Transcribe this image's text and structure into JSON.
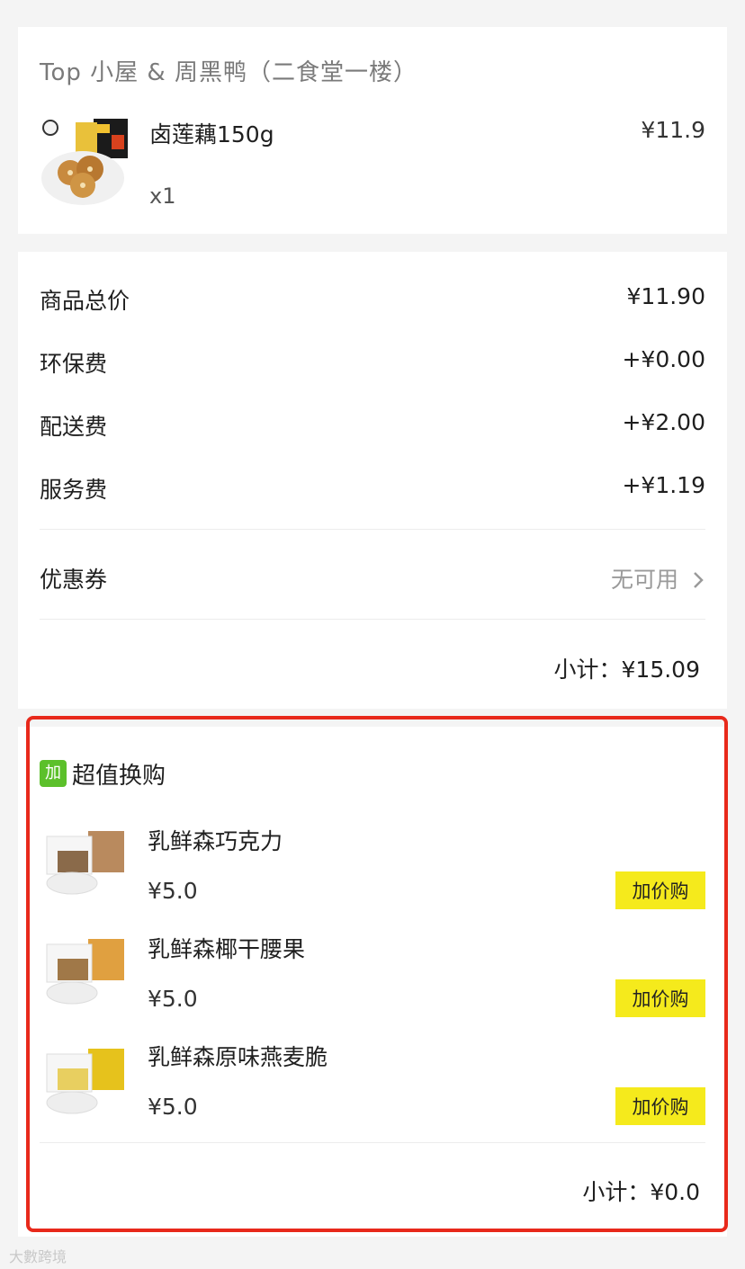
{
  "store": {
    "name": "Top 小屋 & 周黑鸭（二食堂一楼）",
    "item": {
      "name": "卤莲藕150g",
      "price": "¥11.9",
      "qty": "x1",
      "thumb_icon": "lotus-root-product-icon"
    }
  },
  "fees": {
    "rows": [
      {
        "label": "商品总价",
        "value": "¥11.90"
      },
      {
        "label": "环保费",
        "value": "+¥0.00"
      },
      {
        "label": "配送费",
        "value": "+¥2.00"
      },
      {
        "label": "服务费",
        "value": "+¥1.19"
      }
    ],
    "coupon": {
      "label": "优惠券",
      "value": "无可用",
      "icon": "chevron-right-icon"
    },
    "subtotal": "小计：¥15.09"
  },
  "addon": {
    "badge": "加",
    "title": "超值换购",
    "items": [
      {
        "name": "乳鲜森巧克力",
        "price": "¥5.0",
        "button": "加价购",
        "accent": "#b98a5e"
      },
      {
        "name": "乳鲜森椰干腰果",
        "price": "¥5.0",
        "button": "加价购",
        "accent": "#e0a040"
      },
      {
        "name": "乳鲜森原味燕麦脆",
        "price": "¥5.0",
        "button": "加价购",
        "accent": "#e6c21c"
      }
    ],
    "subtotal": "小计：¥0.0"
  },
  "colors": {
    "accent_green": "#5cc02b",
    "button_yellow": "#f5ea1c",
    "highlight_red": "#e8291b"
  }
}
